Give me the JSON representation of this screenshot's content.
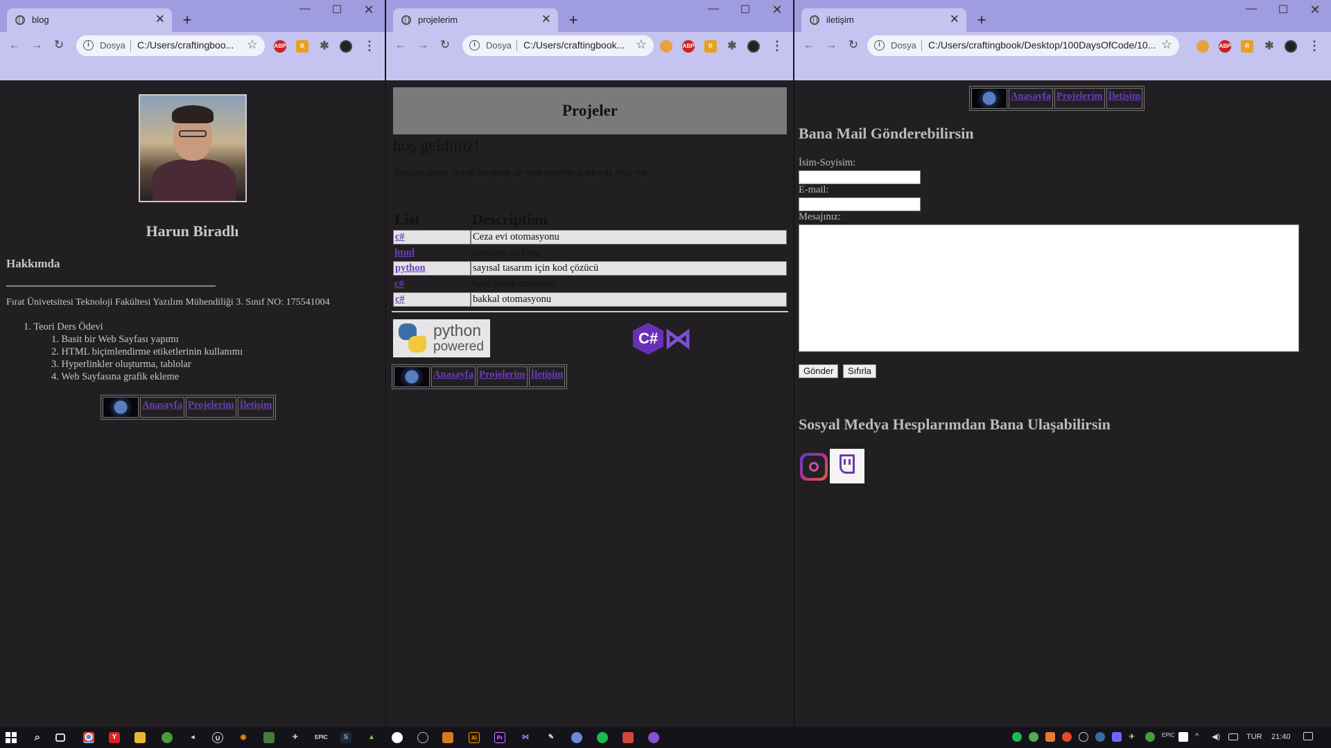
{
  "windows": {
    "blog": {
      "tab_title": "blog",
      "url_scheme": "Dosya",
      "url": "C:/Users/craftingboo...",
      "page": {
        "name": "Harun Biradlı",
        "about_heading": "Hakkımda",
        "info": "Fırat Ünivetsitesi Teknoloji Fakültesi Yazılım Mühendiliği 3. Sınıf NO: 175541004",
        "list_top": "1. Teori Ders Ödevi",
        "list_items": [
          "1. Basit bir Web Sayfası yapımı",
          "2. HTML biçimlendirme etiketlerinin kullanımı",
          "3. Hyperlinkler oluşturma, tablolar",
          "4. Web Sayfasına grafik ekleme"
        ],
        "nav": [
          "Anasayfa",
          "Projelerim",
          "İletişim"
        ]
      }
    },
    "projelerim": {
      "tab_title": "projelerim",
      "url_scheme": "Dosya",
      "url": "C:/Users/craftingbook...",
      "page": {
        "header": "Projeler",
        "welcome": "hoş geldiniz!",
        "description": "Aşağıda genel olarak kendime ait olan projeler hakkında bilgi var.",
        "table_headers": [
          "List",
          "Description"
        ],
        "rows": [
          {
            "link": "c#",
            "desc": "Ceza evi otomasyonu"
          },
          {
            "link": "html",
            "desc": "kendime ait blog"
          },
          {
            "link": "python",
            "desc": "sayısal tasarım için kod çözücü"
          },
          {
            "link": "c#",
            "desc": "basit hesap makinesi"
          },
          {
            "link": "c#",
            "desc": "bakkal otomasyonu"
          }
        ],
        "python_logo_line1": "python",
        "python_logo_line2": "powered",
        "cs_logo": "C#",
        "nav": [
          "Anasayfa",
          "Projelerim",
          "İletişim"
        ]
      }
    },
    "iletisim": {
      "tab_title": "iletişim",
      "url_scheme": "Dosya",
      "url": "C:/Users/craftingbook/Desktop/100DaysOfCode/10...",
      "page": {
        "nav": [
          "Anasayfa",
          "Projelerim",
          "İletişim"
        ],
        "mail_heading": "Bana Mail Gönderebilirsin",
        "name_label": "İsim-Soyisim:",
        "email_label": "E-mail:",
        "message_label": "Mesajınız:",
        "submit": "Gönder",
        "reset": "Sıfırla",
        "social_heading": "Sosyal Medya Hesplarımdan Bana Ulaşabilirsin"
      }
    }
  },
  "taskbar": {
    "language": "TUR",
    "time": "21:40"
  }
}
